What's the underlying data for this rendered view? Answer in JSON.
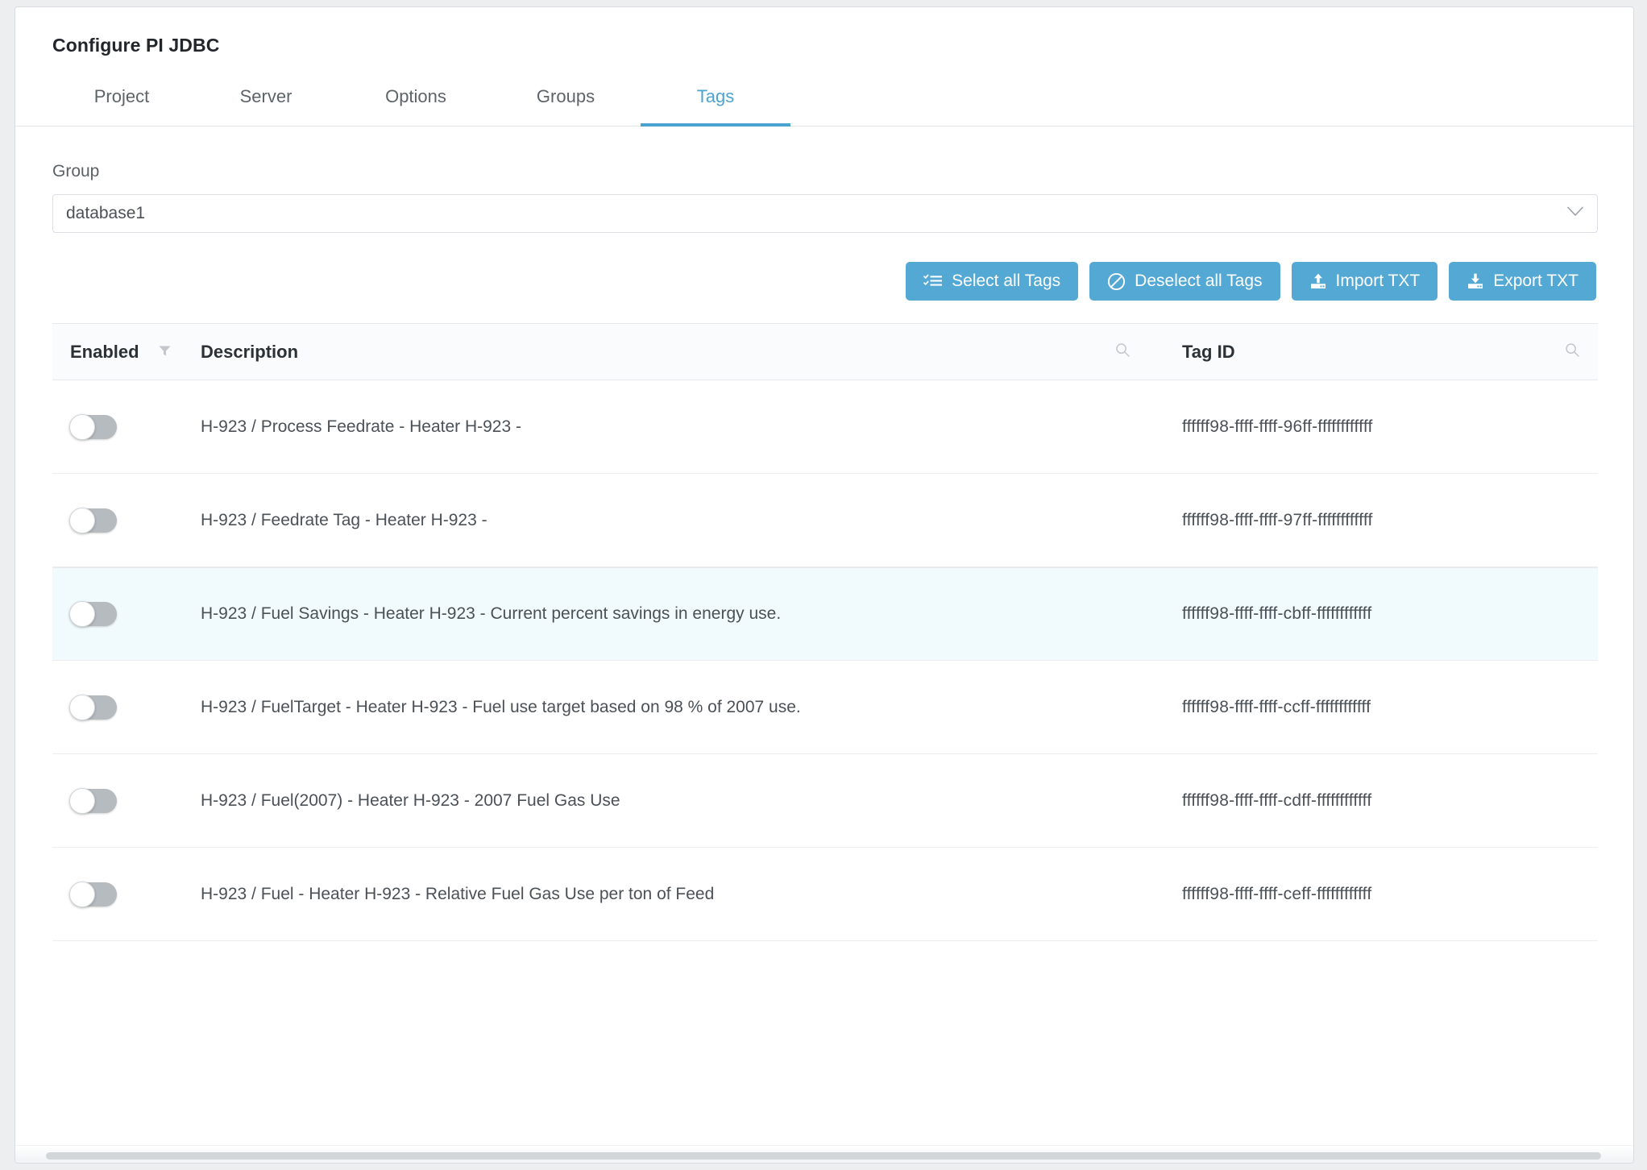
{
  "window": {
    "title": "Configure PI JDBC"
  },
  "tabs": [
    {
      "label": "Project",
      "active": false
    },
    {
      "label": "Server",
      "active": false
    },
    {
      "label": "Options",
      "active": false
    },
    {
      "label": "Groups",
      "active": false
    },
    {
      "label": "Tags",
      "active": true
    }
  ],
  "group_field": {
    "label": "Group",
    "value": "database1",
    "caret_icon": "chevron-down-icon"
  },
  "toolbar": {
    "select_all_label": "Select all Tags",
    "select_all_icon": "list-check-icon",
    "deselect_all_label": "Deselect all Tags",
    "deselect_all_icon": "ban-icon",
    "import_label": "Import TXT",
    "import_icon": "upload-icon",
    "export_label": "Export TXT",
    "export_icon": "download-icon"
  },
  "table": {
    "columns": {
      "enabled": "Enabled",
      "description": "Description",
      "tag_id": "Tag ID"
    },
    "column_icons": {
      "enabled": "filter-icon",
      "description": "search-icon",
      "tag_id": "search-icon"
    },
    "rows": [
      {
        "enabled": false,
        "description": "H-923 / Process Feedrate - Heater H-923 -",
        "tag_id": "ffffff98-ffff-ffff-96ff-ffffffffffff",
        "highlighted": false
      },
      {
        "enabled": false,
        "description": "H-923 / Feedrate Tag - Heater H-923 -",
        "tag_id": "ffffff98-ffff-ffff-97ff-ffffffffffff",
        "highlighted": false
      },
      {
        "enabled": false,
        "description": "H-923 / Fuel Savings - Heater H-923 - Current percent savings in energy use.",
        "tag_id": "ffffff98-ffff-ffff-cbff-ffffffffffff",
        "highlighted": true
      },
      {
        "enabled": false,
        "description": "H-923 / FuelTarget - Heater H-923 - Fuel use target based on 98 % of 2007 use.",
        "tag_id": "ffffff98-ffff-ffff-ccff-ffffffffffff",
        "highlighted": false
      },
      {
        "enabled": false,
        "description": "H-923 / Fuel(2007) - Heater H-923 - 2007 Fuel Gas Use",
        "tag_id": "ffffff98-ffff-ffff-cdff-ffffffffffff",
        "highlighted": false
      },
      {
        "enabled": false,
        "description": "H-923 / Fuel - Heater H-923 - Relative Fuel Gas Use per ton of Feed",
        "tag_id": "ffffff98-ffff-ffff-ceff-ffffffffffff",
        "highlighted": false
      }
    ]
  },
  "colors": {
    "accent": "#4ba3cf",
    "button": "#54a9d4",
    "row_highlight": "#f1fafc"
  }
}
